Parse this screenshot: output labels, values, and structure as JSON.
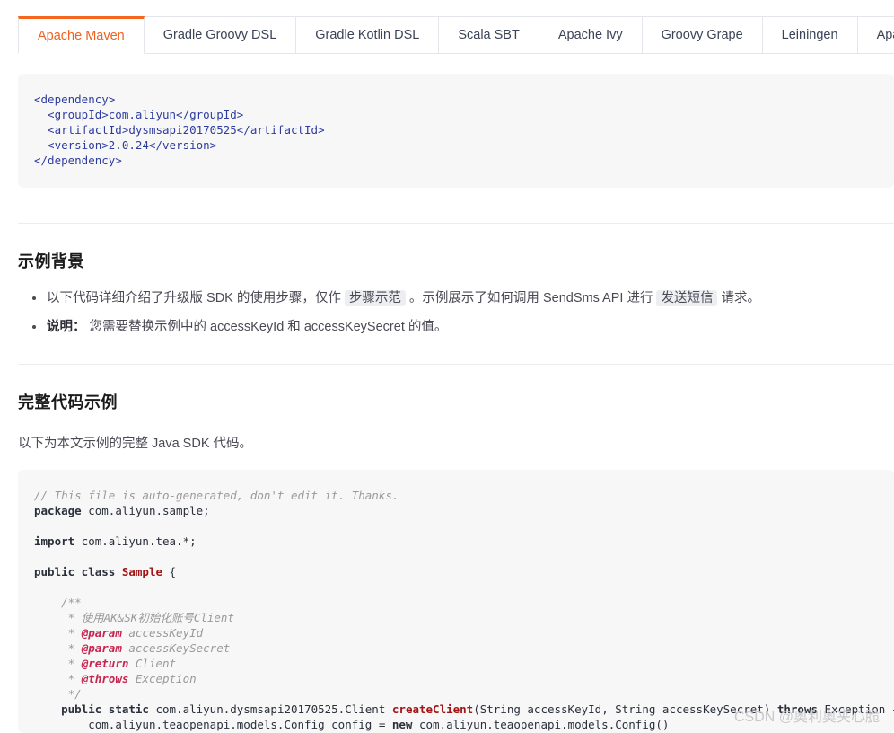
{
  "tabs": [
    {
      "label": "Apache Maven",
      "active": true
    },
    {
      "label": "Gradle Groovy DSL",
      "active": false
    },
    {
      "label": "Gradle Kotlin DSL",
      "active": false
    },
    {
      "label": "Scala SBT",
      "active": false
    },
    {
      "label": "Apache Ivy",
      "active": false
    },
    {
      "label": "Groovy Grape",
      "active": false
    },
    {
      "label": "Leiningen",
      "active": false
    },
    {
      "label": "Apache Buildr",
      "active": false
    }
  ],
  "dependency_snippet": {
    "language": "xml",
    "lines": [
      "<dependency>",
      "  <groupId>com.aliyun</groupId>",
      "  <artifactId>dysmsapi20170525</artifactId>",
      "  <version>2.0.24</version>",
      "</dependency>"
    ],
    "group_id": "com.aliyun",
    "artifact_id": "dysmsapi20170525",
    "version": "2.0.24"
  },
  "background_section": {
    "title": "示例背景",
    "bullets": [
      {
        "parts": [
          {
            "text": "以下代码详细介绍了升级版 SDK 的使用步骤，仅作 ",
            "style": "normal"
          },
          {
            "text": "步骤示范",
            "style": "highlight"
          },
          {
            "text": " 。示例展示了如何调用 SendSms API 进行 ",
            "style": "normal"
          },
          {
            "text": "发送短信",
            "style": "highlight"
          },
          {
            "text": " 请求。",
            "style": "normal"
          }
        ]
      },
      {
        "parts": [
          {
            "text": "说明：",
            "style": "bold"
          },
          {
            "text": " 您需要替换示例中的 accessKeyId 和 accessKeySecret 的值。",
            "style": "normal"
          }
        ]
      }
    ]
  },
  "code_section": {
    "title": "完整代码示例",
    "lead": "以下为本文示例的完整 Java SDK 代码。",
    "code_lines": [
      {
        "indent": 0,
        "segments": [
          {
            "text": "// This file is auto-generated, don't edit it. Thanks.",
            "cls": "comment"
          }
        ]
      },
      {
        "indent": 0,
        "segments": [
          {
            "text": "package",
            "cls": "kw-bold"
          },
          {
            "text": " com.aliyun.sample;",
            "cls": ""
          }
        ]
      },
      {
        "indent": 0,
        "segments": []
      },
      {
        "indent": 0,
        "segments": [
          {
            "text": "import",
            "cls": "kw-bold"
          },
          {
            "text": " com.aliyun.tea.*;",
            "cls": ""
          }
        ]
      },
      {
        "indent": 0,
        "segments": []
      },
      {
        "indent": 0,
        "segments": [
          {
            "text": "public class",
            "cls": "kw-bold"
          },
          {
            "text": " ",
            "cls": ""
          },
          {
            "text": "Sample",
            "cls": "kw-class"
          },
          {
            "text": " {",
            "cls": ""
          }
        ]
      },
      {
        "indent": 0,
        "segments": []
      },
      {
        "indent": 1,
        "segments": [
          {
            "text": "/**",
            "cls": "jdoc"
          }
        ]
      },
      {
        "indent": 1,
        "segments": [
          {
            "text": " * 使用AK&SK初始化账号Client",
            "cls": "jdoc"
          }
        ]
      },
      {
        "indent": 1,
        "segments": [
          {
            "text": " * ",
            "cls": "jdoc"
          },
          {
            "text": "@param",
            "cls": "jdoc-tag"
          },
          {
            "text": " accessKeyId",
            "cls": "jdoc"
          }
        ]
      },
      {
        "indent": 1,
        "segments": [
          {
            "text": " * ",
            "cls": "jdoc"
          },
          {
            "text": "@param",
            "cls": "jdoc-tag"
          },
          {
            "text": " accessKeySecret",
            "cls": "jdoc"
          }
        ]
      },
      {
        "indent": 1,
        "segments": [
          {
            "text": " * ",
            "cls": "jdoc"
          },
          {
            "text": "@return",
            "cls": "jdoc-tag"
          },
          {
            "text": " Client",
            "cls": "jdoc"
          }
        ]
      },
      {
        "indent": 1,
        "segments": [
          {
            "text": " * ",
            "cls": "jdoc"
          },
          {
            "text": "@throws",
            "cls": "jdoc-tag"
          },
          {
            "text": " Exception",
            "cls": "jdoc"
          }
        ]
      },
      {
        "indent": 1,
        "segments": [
          {
            "text": " */",
            "cls": "jdoc"
          }
        ]
      },
      {
        "indent": 1,
        "segments": [
          {
            "text": "public static",
            "cls": "kw-bold"
          },
          {
            "text": " com.aliyun.dysmsapi20170525.Client ",
            "cls": ""
          },
          {
            "text": "createClient",
            "cls": "fn"
          },
          {
            "text": "(String accessKeyId, String accessKeySecret) ",
            "cls": ""
          },
          {
            "text": "throws",
            "cls": "kw-bold"
          },
          {
            "text": " Exception {",
            "cls": ""
          }
        ]
      },
      {
        "indent": 2,
        "segments": [
          {
            "text": "com.aliyun.teaopenapi.models.Config config = ",
            "cls": ""
          },
          {
            "text": "new",
            "cls": "kw-bold"
          },
          {
            "text": " com.aliyun.teaopenapi.models.Config()",
            "cls": ""
          }
        ]
      }
    ]
  },
  "watermark": "CSDN @奥利奥夹心脆"
}
